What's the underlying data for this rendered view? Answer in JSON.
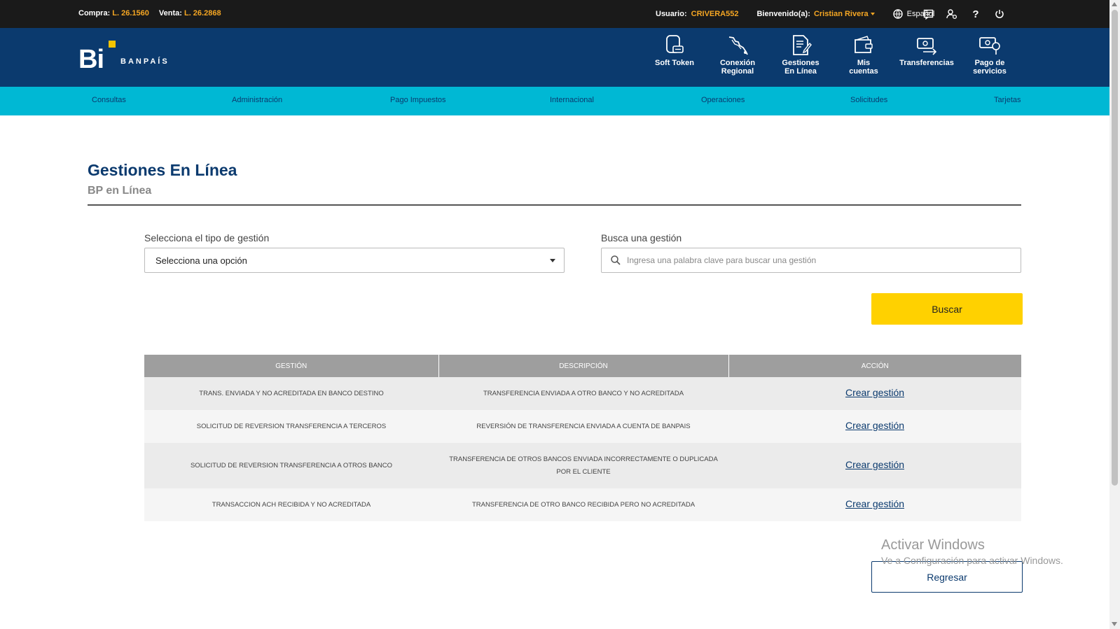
{
  "topbar": {
    "buy_label": "Compra:",
    "buy_value": "L. 26.1560",
    "sell_label": "Venta:",
    "sell_value": "L. 26.2868",
    "user_label": "Usuario:",
    "user_value": "CRIVERA552",
    "welcome_label": "Bienvenido(a):",
    "welcome_name": "Cristian Rivera",
    "language": "Español",
    "help_glyph": "?"
  },
  "brand": {
    "logo_text": "Bi",
    "name": "BANPAÍS"
  },
  "nav_icons": [
    {
      "l1": "Soft Token",
      "l2": "",
      "icon": "soft-token-icon"
    },
    {
      "l1": "Conexión",
      "l2": "Regional",
      "icon": "regional-connection-icon"
    },
    {
      "l1": "Gestiones",
      "l2": "En Línea",
      "icon": "online-management-icon"
    },
    {
      "l1": "Mis",
      "l2": "cuentas",
      "icon": "wallet-icon"
    },
    {
      "l1": "Transferencias",
      "l2": "",
      "icon": "transfer-icon"
    },
    {
      "l1": "Pago de",
      "l2": "servicios",
      "icon": "service-payment-icon"
    }
  ],
  "menu": [
    "Consultas",
    "Administración",
    "Pago Impuestos",
    "Internacional",
    "Operaciones",
    "Solicitudes",
    "Tarjetas"
  ],
  "page": {
    "title": "Gestiones En Línea",
    "subtitle": "BP en Línea"
  },
  "form": {
    "type_label": "Selecciona el tipo de gestión",
    "type_selected": "Selecciona una opción",
    "search_label": "Busca una gestión",
    "search_placeholder": "Ingresa una palabra clave para buscar una gestión",
    "search_button": "Buscar"
  },
  "table": {
    "headers": [
      "GESTIÓN",
      "DESCRIPCIÓN",
      "ACCIÓN"
    ],
    "rows": [
      {
        "gestion": "TRANS. ENVIADA Y NO ACREDITADA EN BANCO DESTINO",
        "descripcion": "TRANSFERENCIA ENVIADA A OTRO BANCO Y NO ACREDITADA",
        "accion": "Crear gestión"
      },
      {
        "gestion": "SOLICITUD DE REVERSION TRANSFERENCIA A TERCEROS",
        "descripcion": "REVERSIÓN DE TRANSFERENCIA ENVIADA A CUENTA DE BANPAIS",
        "accion": "Crear gestión"
      },
      {
        "gestion": "SOLICITUD DE REVERSION TRANSFERENCIA A OTROS BANCO",
        "descripcion": "TRANSFERENCIA DE OTROS BANCOS ENVIADA INCORRECTAMENTE O DUPLICADA POR EL CLIENTE",
        "accion": "Crear gestión"
      },
      {
        "gestion": "TRANSACCION ACH RECIBIDA Y NO ACREDITADA",
        "descripcion": "TRANSFERENCIA DE OTRO BANCO RECIBIDA PERO NO ACREDITADA",
        "accion": "Crear gestión"
      }
    ]
  },
  "back_button": "Regresar",
  "watermark": {
    "line1": "Activar Windows",
    "line2": "Ve a Configuración para activar Windows."
  },
  "colors": {
    "topbar": "#1a1a1a",
    "header": "#0b3a6e",
    "menubar": "#00b8d4",
    "accent": "#f5a623",
    "button": "#ffd100"
  }
}
